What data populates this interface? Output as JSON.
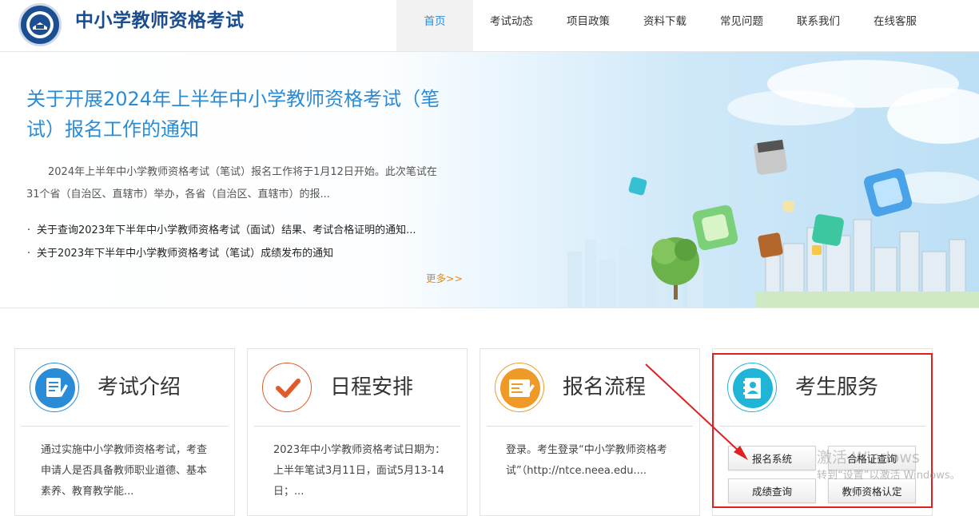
{
  "header": {
    "site_title": "中小学教师资格考试",
    "nav": [
      {
        "label": "首页",
        "active": true
      },
      {
        "label": "考试动态",
        "active": false
      },
      {
        "label": "项目政策",
        "active": false
      },
      {
        "label": "资料下载",
        "active": false
      },
      {
        "label": "常见问题",
        "active": false
      },
      {
        "label": "联系我们",
        "active": false
      },
      {
        "label": "在线客服",
        "active": false
      }
    ]
  },
  "banner": {
    "headline": "关于开展2024年上半年中小学教师资格考试（笔试）报名工作的通知",
    "summary": "2024年上半年中小学教师资格考试（笔试）报名工作将于1月12日开始。此次笔试在31个省（自治区、直辖市）举办，各省（自治区、直辖市）的报...",
    "news": [
      "关于查询2023年下半年中小学教师资格考试（面试）结果、考试合格证明的通知...",
      "关于2023年下半年中小学教师资格考试（笔试）成绩发布的通知"
    ],
    "more": "更多>>"
  },
  "cards": [
    {
      "title": "考试介绍",
      "text": "通过实施中小学教师资格考试，考查申请人是否具备教师职业道德、基本素养、教育教学能...",
      "icon": "document-pen-icon",
      "color": "#2a8bd6"
    },
    {
      "title": "日程安排",
      "text": "2023年中小学教师资格考试日期为：上半年笔试3月11日，面试5月13-14日；...",
      "icon": "checkmark-icon",
      "color": "#e05a2b"
    },
    {
      "title": "报名流程",
      "text": "登录。考生登录“中小学教师资格考试”（http://ntce.neea.edu....",
      "icon": "form-edit-icon",
      "color": "#ef9a27"
    },
    {
      "title": "考生服务",
      "icon": "contact-book-icon",
      "color": "#20b5d6",
      "buttons": [
        "报名系统",
        "合格证查询",
        "成绩查询",
        "教师资格认定"
      ]
    }
  ],
  "watermark": {
    "line1": "激活 Windows",
    "line2": "转到“设置”以激活 Windows。"
  },
  "colors": {
    "brand": "#1a4d8f",
    "link": "#2a8bd6",
    "more": "#e08a1b",
    "annotation": "#e02020"
  }
}
